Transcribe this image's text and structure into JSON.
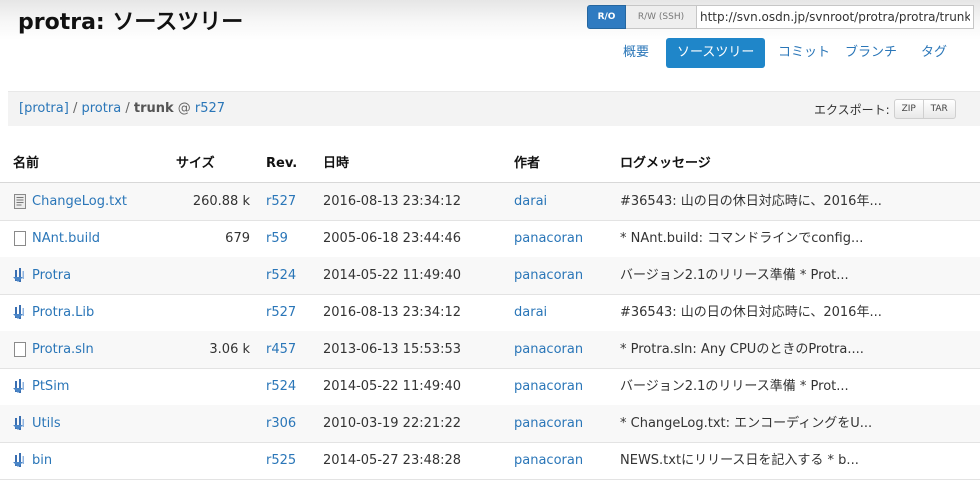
{
  "header": {
    "title": "protra: ソースツリー",
    "repo": {
      "ro_label": "R/O",
      "rw_label": "R/W (SSH)",
      "url": "http://svn.osdn.jp/svnroot/protra/protra/trunk"
    }
  },
  "nav": {
    "items": [
      {
        "label": "概要",
        "active": false
      },
      {
        "label": "ソースツリー",
        "active": true
      },
      {
        "label": "コミット",
        "active": false
      },
      {
        "label": "ブランチ",
        "active": false
      },
      {
        "label": "タグ",
        "active": false
      }
    ]
  },
  "breadcrumb": {
    "root": "[protra]",
    "sep1": "/",
    "project": "protra",
    "sep2": "/",
    "branch": "trunk",
    "at": "@",
    "rev": "r527"
  },
  "export": {
    "label": "エクスポート:",
    "zip": "ZIP",
    "tar": "TAR"
  },
  "table": {
    "columns": {
      "name": "名前",
      "size": "サイズ",
      "rev": "Rev.",
      "date": "日時",
      "author": "作者",
      "log": "ログメッセージ"
    },
    "rows": [
      {
        "icon": "text-file-icon",
        "name": "ChangeLog.txt",
        "size": "260.88 k",
        "rev": "r527",
        "date": "2016-08-13 23:34:12",
        "author": "darai",
        "log": "#36543: 山の日の休日対応時に、2016年..."
      },
      {
        "icon": "file-icon",
        "name": "NAnt.build",
        "size": "679",
        "rev": "r59",
        "date": "2005-06-18 23:44:46",
        "author": "panacoran",
        "log": "* NAnt.build: コマンドラインでconfig..."
      },
      {
        "icon": "folder-icon",
        "name": "Protra",
        "size": "",
        "rev": "r524",
        "date": "2014-05-22 11:49:40",
        "author": "panacoran",
        "log": "バージョン2.1のリリース準備 * Prot..."
      },
      {
        "icon": "folder-icon",
        "name": "Protra.Lib",
        "size": "",
        "rev": "r527",
        "date": "2016-08-13 23:34:12",
        "author": "darai",
        "log": "#36543: 山の日の休日対応時に、2016年..."
      },
      {
        "icon": "file-icon",
        "name": "Protra.sln",
        "size": "3.06 k",
        "rev": "r457",
        "date": "2013-06-13 15:53:53",
        "author": "panacoran",
        "log": "* Protra.sln: Any CPUのときのProtra...."
      },
      {
        "icon": "folder-icon",
        "name": "PtSim",
        "size": "",
        "rev": "r524",
        "date": "2014-05-22 11:49:40",
        "author": "panacoran",
        "log": "バージョン2.1のリリース準備 * Prot..."
      },
      {
        "icon": "folder-icon",
        "name": "Utils",
        "size": "",
        "rev": "r306",
        "date": "2010-03-19 22:21:22",
        "author": "panacoran",
        "log": "* ChangeLog.txt: エンコーディングをU..."
      },
      {
        "icon": "folder-icon",
        "name": "bin",
        "size": "",
        "rev": "r525",
        "date": "2014-05-27 23:48:28",
        "author": "panacoran",
        "log": "NEWS.txtにリリース日を記入する * b..."
      }
    ]
  },
  "colors": {
    "link": "#2a76b8",
    "active_tab": "#1f86c9",
    "ro_button": "#2f7bc1"
  }
}
